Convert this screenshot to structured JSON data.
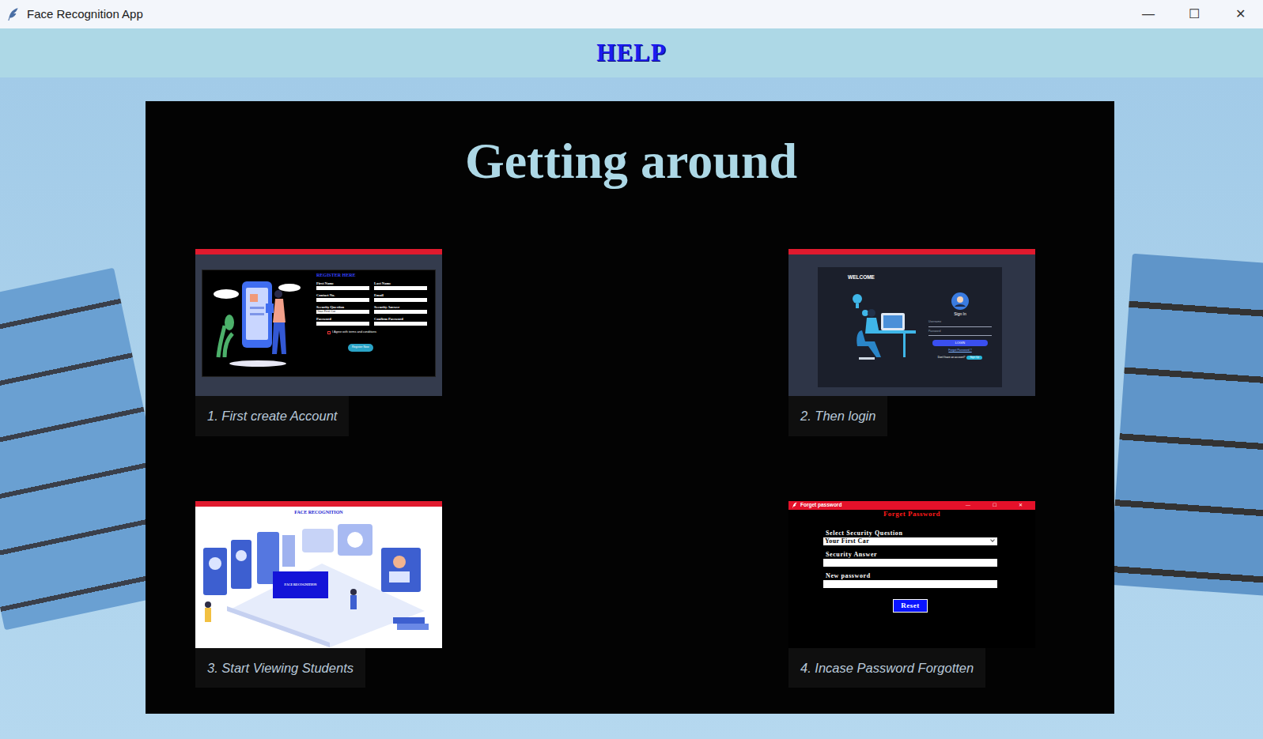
{
  "window": {
    "title": "Face Recognition App",
    "controls": [
      "—",
      "☐",
      "✕"
    ]
  },
  "header": {
    "title": "HELP"
  },
  "panel": {
    "title": "Getting around"
  },
  "steps": [
    {
      "kind": "register",
      "caption": "1. First create Account",
      "screen": {
        "heading": "REGISTER HERE",
        "fields": [
          {
            "label": "First Name",
            "value": ""
          },
          {
            "label": "Last Name",
            "value": ""
          },
          {
            "label": "Contact No.",
            "value": ""
          },
          {
            "label": "Email",
            "value": ""
          },
          {
            "label": "Security Question",
            "value": "Your First Car"
          },
          {
            "label": "Security Answer",
            "value": ""
          },
          {
            "label": "Password",
            "value": ""
          },
          {
            "label": "Confirm Password",
            "value": ""
          }
        ],
        "agree": "I Agree with terms and conditions",
        "checked": false,
        "button": "Register Now"
      }
    },
    {
      "kind": "login",
      "caption": "2. Then login",
      "screen": {
        "heading": "WELCOME",
        "sign_in": "Sign In",
        "fields": [
          "Username",
          "Password"
        ],
        "button": "LOGIN",
        "forgot": "Forgot Password ?",
        "signup_prompt": "Don't have an account?",
        "signup": "Sign Up"
      }
    },
    {
      "kind": "viewer",
      "caption": "3. Start Viewing Students",
      "screen": {
        "heading": "FACE RECOGNITION",
        "button": "FACE RECOGNITION"
      }
    },
    {
      "kind": "forgot",
      "caption": "4. Incase Password Forgotten",
      "screen": {
        "window_title": "Forget password",
        "controls": [
          "—",
          "☐",
          "✕"
        ],
        "heading": "Forget Password",
        "question_label": "Select Security Question",
        "question_value": "Your First Car",
        "answer_label": "Security Answer",
        "password_label": "New password",
        "button": "Reset"
      }
    }
  ]
}
